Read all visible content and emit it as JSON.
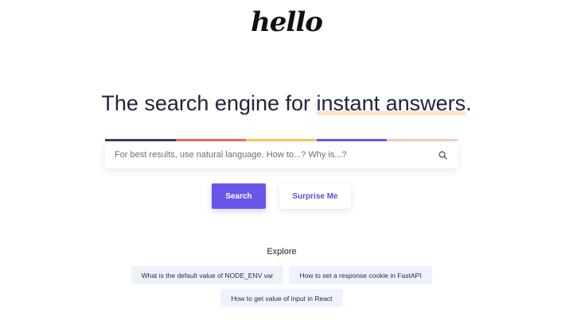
{
  "logo": {
    "text": "hello"
  },
  "headline": {
    "prefix": "The search engine for ",
    "highlight": "instant answers",
    "suffix": "."
  },
  "search": {
    "placeholder": "For best results, use natural language. How to...? Why is...?",
    "value": "",
    "icon": "search-icon",
    "rainbow_colors": [
      "#3b3a6e",
      "#e86a57",
      "#f4c65a",
      "#6a55e9",
      "#f8c7b8"
    ]
  },
  "buttons": {
    "search_label": "Search",
    "surprise_label": "Surprise Me"
  },
  "explore": {
    "title": "Explore",
    "items": [
      "What is the default value of NODE_ENV var",
      "How to set a response cookie in FastAPI",
      "How to get value of input in React"
    ]
  },
  "colors": {
    "accent": "#6a55e9",
    "heading": "#23213f",
    "chip_bg": "#eef3fb",
    "highlight_underline": "#fde3c3"
  }
}
